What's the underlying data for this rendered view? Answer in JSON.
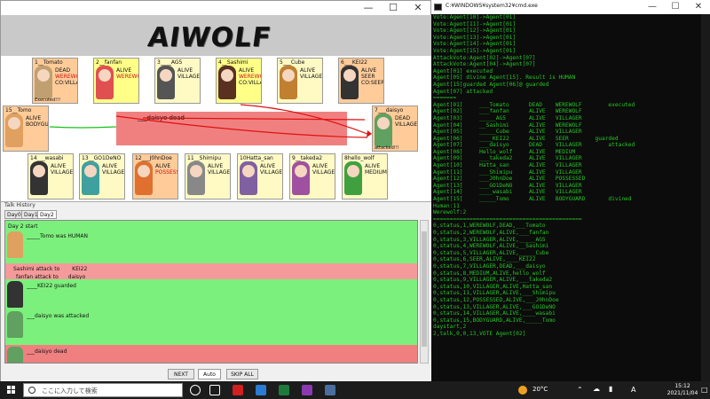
{
  "cmd": {
    "title": "C:¥WINDOWS¥system32¥cmd.exe",
    "lines": [
      "Vote:Agent[10]->Agent[01]",
      "Vote:Agent[11]->Agent[01]",
      "Vote:Agent[12]->Agent[01]",
      "Vote:Agent[13]->Agent[01]",
      "Vote:Agent[14]->Agent[01]",
      "Vote:Agent[15]->Agent[01]",
      "AttackVote:Agent[02]->Agent[07]",
      "AttackVote:Agent[04]->Agent[07]",
      "Agent[01] executed",
      "Agent[05] divine Agent[15]. Result is HUMAN",
      "Agent[15]guarded Agent[06]@ guarded",
      "Agent[07] attacked",
      "=======",
      "Agent[01]     ___Tomato      DEAD    WEREWOLF        executed",
      "Agent[02]     ___fanfan      ALIVE   WEREWOLF",
      "Agent[03]     _____AG5       ALIVE   VILLAGER",
      "Agent[04]     __Sashimi      ALIVE   WEREWOLF",
      "Agent[05]     _____Cube      ALIVE   VILLAGER",
      "Agent[06]     ____KEI22      ALIVE   SEER        guarded",
      "Agent[07]     ___daisyo      DEAD    VILLAGER        attacked",
      "Agent[08]     Hello_wolf     ALIVE   MEDIUM",
      "Agent[09]     ___takeda2     ALIVE   VILLAGER",
      "Agent[10]     Hatta_san      ALIVE   VILLAGER",
      "Agent[11]     ___Shimipu     ALIVE   VILLAGER",
      "Agent[12]     ___J0hnDoe     ALIVE   POSSESSED",
      "Agent[13]     ___GO1DeNO     ALIVE   VILLAGER",
      "Agent[14]     ____wasabi     ALIVE   VILLAGER",
      "Agent[15]     _____Tomo      ALIVE   BODYGUARD       divined",
      "Human:11",
      "Werewolf:2",
      "=============================================",
      "0,status,1,WEREWOLF,DEAD,___Tomato",
      "0,status,2,WEREWOLF,ALIVE,___fanfan",
      "0,status,3,VILLAGER,ALIVE,_____AG5",
      "0,status,4,WEREWOLF,ALIVE,__Sashimi",
      "0,status,5,VILLAGER,ALIVE,_____Cube",
      "0,status,6,SEER,ALIVE,____KEI22",
      "0,status,7,VILLAGER,DEAD,___daisyo",
      "0,status,8,MEDIUM,ALIVE,hello_wolf",
      "0,status,9,VILLAGER,ALIVE,___takeda2",
      "0,status,10,VILLAGER,ALIVE,Hatta_san",
      "0,status,11,VILLAGER,ALIVE,___Shimipu",
      "0,status,12,POSSESSED,ALIVE,___J0hnDoe",
      "0,status,13,VILLAGER,ALIVE,___GO1DeNO",
      "0,status,14,VILLAGER,ALIVE,____wasabi",
      "0,status,15,BODYGUARD,ALIVE,_____Tomo",
      "daystart,2",
      "2,talk,0,0,13,VOTE Agent[02]"
    ]
  },
  "game": {
    "logo": "AIWOLF",
    "action_text": "___daisyo dead",
    "colors": {
      "villager_card": "#fff9c4",
      "dead_card": "#ffcc99",
      "highlight_card": "#ffff88",
      "talk_row": "#7cf07c",
      "attack_row": "#f59a9a",
      "dead_row": "#f08080"
    },
    "agents": [
      {
        "id": "a01",
        "name": "1__Tomato",
        "status": "DEAD",
        "role": "WEREWOLF",
        "role2": "CO:VILLAGE",
        "extra": "Executed!!!",
        "bg": "#ffcc99",
        "hair": "#c0a070"
      },
      {
        "id": "a02",
        "name": "2__fanfan",
        "status": "ALIVE",
        "role": "WEREWOLF",
        "role2": "",
        "extra": "",
        "bg": "#ffff88",
        "hair": "#e05050"
      },
      {
        "id": "a03",
        "name": "3____AG5",
        "status": "ALIVE",
        "role": "VILLAGER",
        "role2": "",
        "extra": "",
        "bg": "#fff9c4",
        "hair": "#555"
      },
      {
        "id": "a04",
        "name": "4__Sashimi",
        "status": "ALIVE",
        "role": "WEREWOLF",
        "role2": "CO:VILLAGE",
        "extra": "",
        "bg": "#ffff88",
        "hair": "#5a3020"
      },
      {
        "id": "a05",
        "name": "5___Cube",
        "status": "ALIVE",
        "role": "VILLAGER",
        "role2": "",
        "extra": "",
        "bg": "#fff9c4",
        "hair": "#c08030"
      },
      {
        "id": "a06",
        "name": "6___KEI22",
        "status": "ALIVE",
        "role": "SEER",
        "role2": "CO:SEER",
        "extra": "",
        "bg": "#ffcc99",
        "hair": "#333"
      },
      {
        "id": "a15",
        "name": "15__Tomo",
        "status": "ALIVE",
        "role": "BODYGUARD",
        "role2": "",
        "extra": "",
        "bg": "#ffcc99",
        "hair": "#e0a060"
      },
      {
        "id": "a07",
        "name": "7___daisyo",
        "status": "DEAD",
        "role": "VILLAGER",
        "role2": "",
        "extra": "attacked!!!",
        "bg": "#ffcc99",
        "hair": "#60a060"
      },
      {
        "id": "a14",
        "name": "14___wasabi",
        "status": "ALIVE",
        "role": "VILLAGER",
        "role2": "",
        "extra": "",
        "bg": "#fff9c4",
        "hair": "#333"
      },
      {
        "id": "a13",
        "name": "13__GO1DeNO",
        "status": "ALIVE",
        "role": "VILLAGER",
        "role2": "",
        "extra": "",
        "bg": "#fff9c4",
        "hair": "#40a0a0"
      },
      {
        "id": "a12",
        "name": "12___J0hnDoe",
        "status": "ALIVE",
        "role": "POSSESSED",
        "role2": "",
        "extra": "",
        "bg": "#ffcc99",
        "hair": "#e07030"
      },
      {
        "id": "a11",
        "name": "11__Shimipu",
        "status": "ALIVE",
        "role": "VILLAGER",
        "role2": "",
        "extra": "",
        "bg": "#fff9c4",
        "hair": "#888"
      },
      {
        "id": "a10",
        "name": "10Hatta_san",
        "status": "ALIVE",
        "role": "VILLAGER",
        "role2": "",
        "extra": "",
        "bg": "#fff9c4",
        "hair": "#8060a0"
      },
      {
        "id": "a09",
        "name": "9__takeda2",
        "status": "ALIVE",
        "role": "VILLAGER",
        "role2": "",
        "extra": "",
        "bg": "#fff9c4",
        "hair": "#a050a0"
      },
      {
        "id": "a08",
        "name": "8hello_wolf",
        "status": "ALIVE",
        "role": "MEDIUM",
        "role2": "",
        "extra": "",
        "bg": "#fff9c4",
        "hair": "#40a040"
      }
    ],
    "history": {
      "label": "Talk History",
      "tabs": [
        "Day0",
        "Day1",
        "Day2"
      ],
      "rows": [
        {
          "text": "Day 2 start",
          "bg": "#7cf07c",
          "face": "",
          "nohead": true
        },
        {
          "text": "_____Tomo was HUMAN",
          "bg": "#7cf07c",
          "face": "#e0a060"
        },
        {
          "text": "__Sashimi attack to ____KEI22",
          "bg": "#f59a9a",
          "face": "",
          "nohead": true
        },
        {
          "text": "___fanfan attack to ___daisyo",
          "bg": "#f59a9a",
          "face": "",
          "nohead": true
        },
        {
          "text": "____KEI22 guarded",
          "bg": "#7cf07c",
          "face": "#333"
        },
        {
          "text": "___daisyo was attacked",
          "bg": "#7cf07c",
          "face": "#60a060"
        },
        {
          "text": "___daisyo dead",
          "bg": "#f08080",
          "face": "#60a060"
        }
      ]
    },
    "buttons": {
      "next": "NEXT",
      "auto": "Auto",
      "skip": "SKIP ALL"
    }
  },
  "taskbar": {
    "search_placeholder": "ここに入力して検索",
    "temperature": "20°C",
    "ime": "A",
    "time": "15:12",
    "date": "2021/11/04"
  }
}
